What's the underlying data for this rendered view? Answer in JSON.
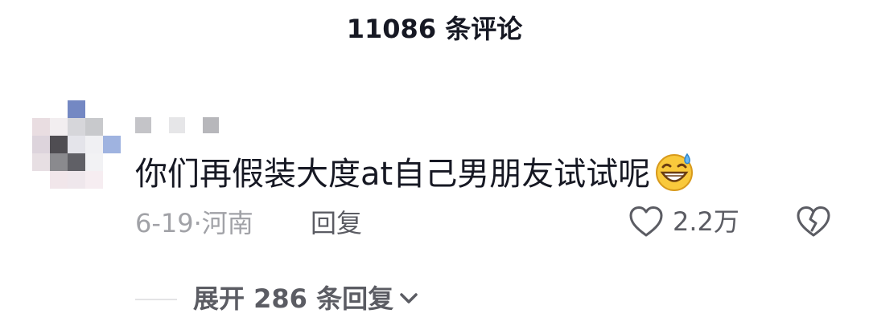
{
  "header": {
    "title": "11086 条评论"
  },
  "comment": {
    "text": "你们再假装大度at自己男朋友试试呢",
    "emoji_icon": "grinning-sweat-emoji",
    "date": "6-19",
    "separator": "·",
    "location": "河南",
    "reply_label": "回复",
    "like_count": "2.2万",
    "like_icon": "heart-outline-icon",
    "dislike_icon": "broken-heart-icon"
  },
  "replies": {
    "expand_label": "展开 286 条回复"
  },
  "colors": {
    "text_primary": "#161823",
    "text_secondary": "#5b5c63",
    "text_muted": "#a1a2a7",
    "avatar_pixels": [
      [
        "#ffffff",
        "#ffffff",
        "#7488c3",
        "#ffffff",
        "#ffffff"
      ],
      [
        "#e9dde1",
        "#f2eef0",
        "#d6d6da",
        "#c8c9cc",
        "#ffffff"
      ],
      [
        "#ddd4dc",
        "#4f4d52",
        "#e4e4ea",
        "#f0f0f3",
        "#9fb3e0"
      ],
      [
        "#e7dfe3",
        "#8a8a8e",
        "#606066",
        "#f2f2f4",
        "#ffffff"
      ],
      [
        "#ffffff",
        "#f1e6ea",
        "#efe7ec",
        "#f6edf1",
        "#ffffff"
      ]
    ],
    "username_pixels": [
      "#c4c4c8",
      "#e6e6e8",
      "#b7b7bb"
    ]
  }
}
